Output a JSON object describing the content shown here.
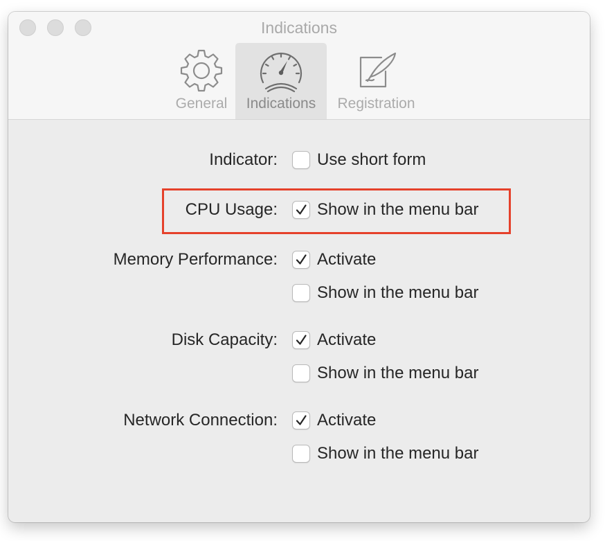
{
  "window": {
    "title": "Indications"
  },
  "toolbar": {
    "tabs": [
      {
        "label": "General",
        "icon": "gear-icon"
      },
      {
        "label": "Indications",
        "icon": "speedometer-icon",
        "selected": true
      },
      {
        "label": "Registration",
        "icon": "pen-on-paper-icon"
      }
    ]
  },
  "settings": {
    "indicator": {
      "label": "Indicator:",
      "options": [
        {
          "text": "Use short form",
          "checked": false
        }
      ]
    },
    "cpu": {
      "label": "CPU Usage:",
      "options": [
        {
          "text": "Show in the menu bar",
          "checked": true
        }
      ]
    },
    "memory": {
      "label": "Memory Performance:",
      "options": [
        {
          "text": "Activate",
          "checked": true
        },
        {
          "text": "Show in the menu bar",
          "checked": false
        }
      ]
    },
    "disk": {
      "label": "Disk Capacity:",
      "options": [
        {
          "text": "Activate",
          "checked": true
        },
        {
          "text": "Show in the menu bar",
          "checked": false
        }
      ]
    },
    "network": {
      "label": "Network Connection:",
      "options": [
        {
          "text": "Activate",
          "checked": true
        },
        {
          "text": "Show in the menu bar",
          "checked": false
        }
      ]
    }
  },
  "colors": {
    "highlight": "#e5412b",
    "window_bg": "#ececec",
    "toolbar_bg": "#f6f6f6",
    "selected_tab_bg": "#e2e2e2"
  }
}
